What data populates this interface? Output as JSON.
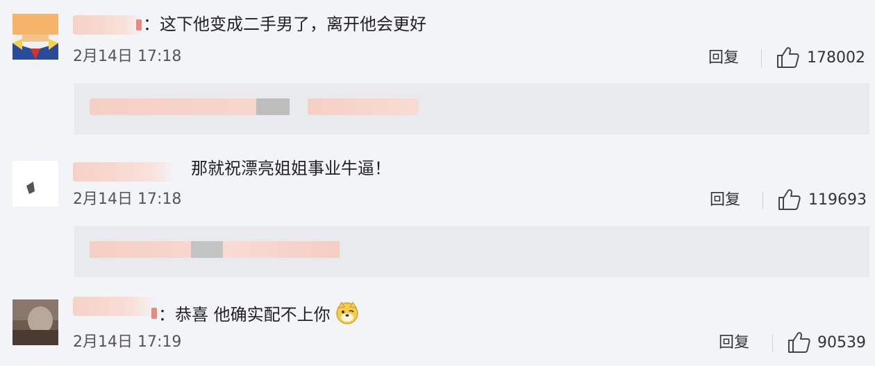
{
  "comments": [
    {
      "text": "：这下他变成二手男了，离开他会更好",
      "time": "2月14日 17:18",
      "reply_label": "回复",
      "likes": "178002"
    },
    {
      "text": "那就祝漂亮姐姐事业牛逼！",
      "time": "2月14日 17:18",
      "reply_label": "回复",
      "likes": "119693"
    },
    {
      "text": "：恭喜 他确实配不上你",
      "time": "2月14日 17:19",
      "reply_label": "回复",
      "likes": "90539"
    }
  ],
  "icons": {
    "like": "thumbs-up-icon",
    "emoji": "dog-face-emoji-icon"
  },
  "colors": {
    "background": "#f3f4f8",
    "subreply_background": "#e9eaee",
    "blur_pink": "#f5d2c8",
    "blur_gray": "#c4c4c4"
  }
}
